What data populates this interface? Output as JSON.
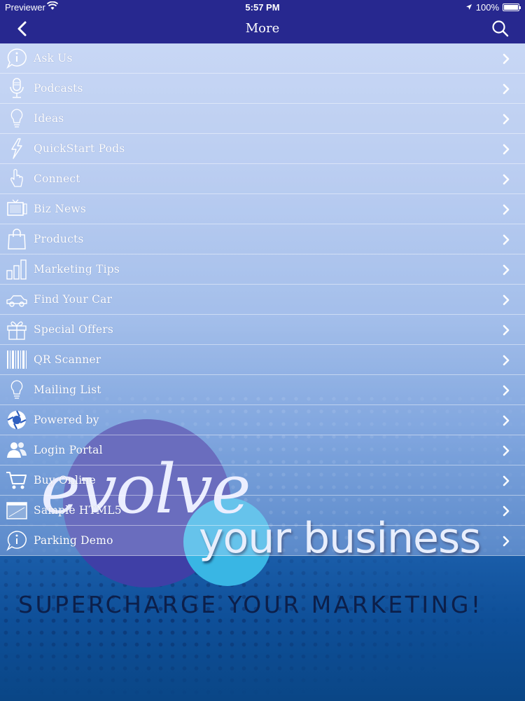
{
  "status_bar": {
    "carrier": "Previewer",
    "time": "5:57 PM",
    "battery": "100%"
  },
  "nav": {
    "title": "More",
    "back_icon": "chevron-left-icon",
    "search_icon": "search-icon"
  },
  "menu": {
    "items": [
      {
        "label": "Ask Us",
        "icon": "info-bubble-icon"
      },
      {
        "label": "Podcasts",
        "icon": "microphone-icon"
      },
      {
        "label": "Ideas",
        "icon": "lightbulb-icon"
      },
      {
        "label": "QuickStart Pods",
        "icon": "lightning-icon"
      },
      {
        "label": "Connect",
        "icon": "pointing-hand-icon"
      },
      {
        "label": "Biz News",
        "icon": "tv-icon"
      },
      {
        "label": "Products",
        "icon": "shopping-bag-icon"
      },
      {
        "label": "Marketing Tips",
        "icon": "bar-chart-icon"
      },
      {
        "label": "Find Your Car",
        "icon": "car-icon"
      },
      {
        "label": "Special Offers",
        "icon": "gift-icon"
      },
      {
        "label": "QR Scanner",
        "icon": "barcode-icon"
      },
      {
        "label": "Mailing List",
        "icon": "lightbulb-icon"
      },
      {
        "label": "Powered by",
        "icon": "aperture-icon"
      },
      {
        "label": "Login Portal",
        "icon": "users-icon"
      },
      {
        "label": "Buy Online",
        "icon": "shopping-cart-icon"
      },
      {
        "label": "Sample HTML5",
        "icon": "browser-window-icon"
      },
      {
        "label": "Parking Demo",
        "icon": "info-bubble-icon"
      }
    ]
  },
  "banner": {
    "evolve": "evolve",
    "your_business": "your business",
    "supercharge": "SUPERCHARGE YOUR MARKETING!"
  },
  "colors": {
    "nav_bar": "#27288f",
    "circle_big": "#3f3fa6",
    "circle_small": "#39b6e4"
  }
}
